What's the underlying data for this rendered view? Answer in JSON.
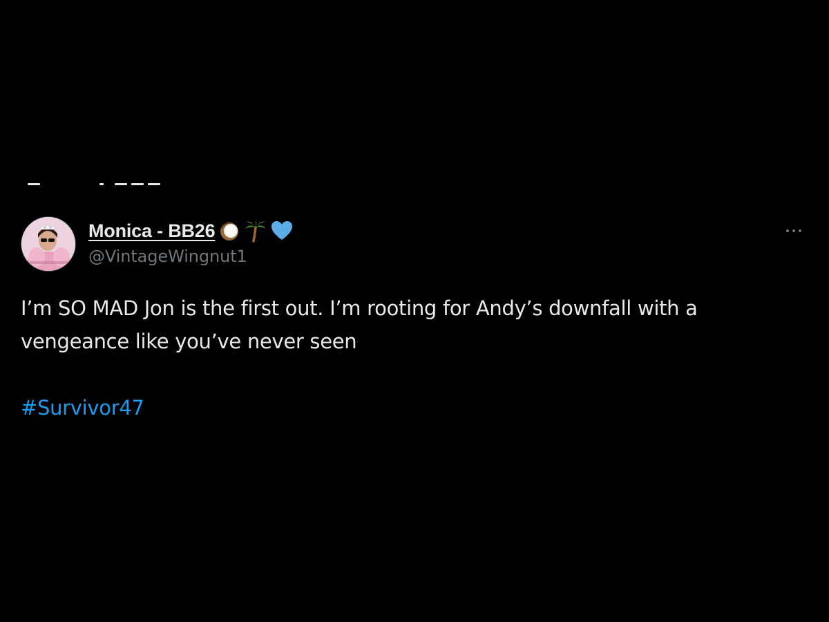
{
  "tweet": {
    "display_name": "Monica - BB26",
    "name_emojis": [
      "coconut-icon",
      "palm-tree-icon",
      "blue-heart-icon"
    ],
    "handle": "@VintageWingnut1",
    "text": "I’m SO MAD Jon is the first out. I’m rooting for Andy’s downfall with a vengeance like you’ve never seen",
    "hashtag": "#Survivor47"
  },
  "colors": {
    "background": "#000000",
    "text_primary": "#e7e9ea",
    "text_secondary": "#71767b",
    "link": "#1d9bf0",
    "heart": "#5cace8",
    "palm_green": "#4a8f2a",
    "coconut_brown": "#8b5a2b"
  },
  "icons": {
    "more": "more-horizontal-icon"
  }
}
